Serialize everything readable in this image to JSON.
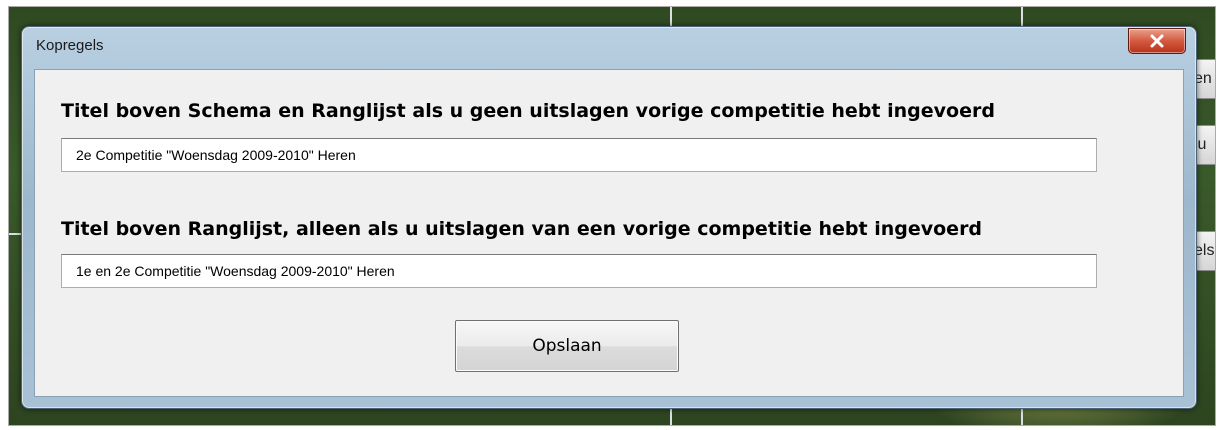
{
  "window": {
    "title": "Kopregels"
  },
  "form": {
    "label1": "Titel boven Schema en Ranglijst als u geen uitslagen vorige competitie hebt ingevoerd",
    "value1": "2e Competitie \"Woensdag 2009-2010\" Heren",
    "label2": "Titel boven Ranglijst, alleen als u uitslagen van een vorige competitie hebt ingevoerd",
    "value2": "1e en 2e Competitie \"Woensdag 2009-2010\" Heren",
    "save_label": "Opslaan"
  },
  "background": {
    "side_buttons": [
      "en",
      "lu",
      "els"
    ]
  },
  "colors": {
    "close_button": "#c8402a",
    "client_area": "#f0f0f0",
    "window_frame": "#a8c1d5"
  }
}
